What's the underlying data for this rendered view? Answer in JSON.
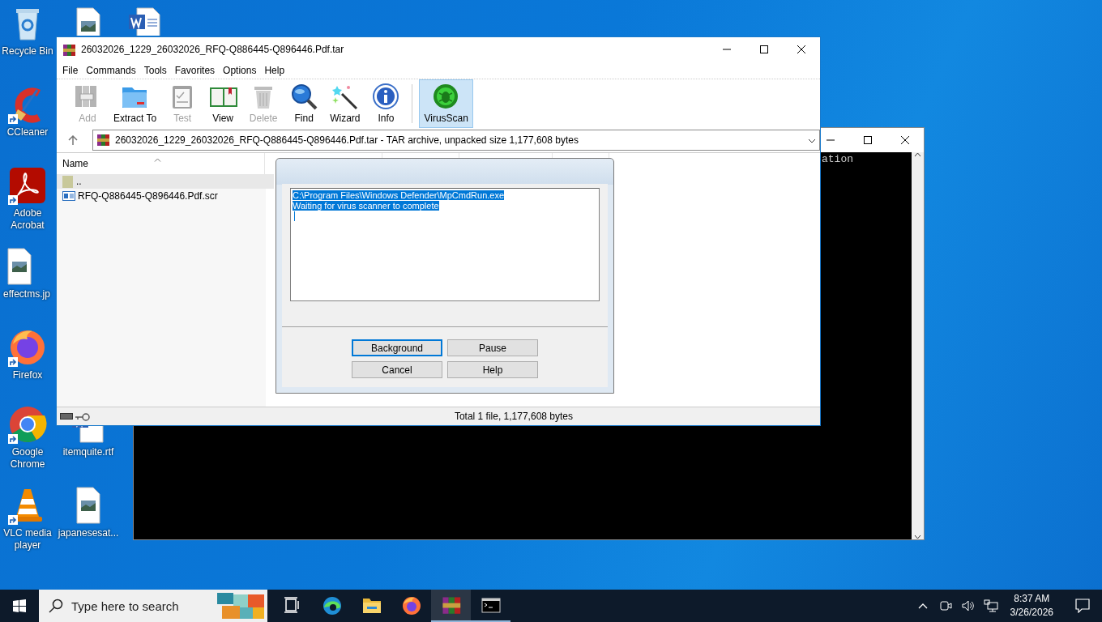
{
  "desktop_icons": [
    {
      "kind": "recycle",
      "label": "Recycle Bin",
      "shortcut": false
    },
    {
      "kind": "image"
    },
    {
      "kind": "word"
    },
    {
      "kind": "ccleaner",
      "label": "CCleaner",
      "shortcut": true
    },
    {
      "kind": "acrobat",
      "label": "Adobe Acrobat",
      "shortcut": true
    },
    {
      "kind": "image",
      "label": "effectms.jp",
      "shortcut": false
    },
    {
      "kind": "firefox",
      "label": "Firefox",
      "shortcut": true
    },
    {
      "kind": "chrome",
      "label": "Google Chrome",
      "shortcut": true
    },
    {
      "kind": "word",
      "label": "itemquite.rtf",
      "shortcut": false
    },
    {
      "kind": "vlc",
      "label": "VLC media player",
      "shortcut": true
    },
    {
      "kind": "image",
      "label": "japanesesat...",
      "shortcut": false
    }
  ],
  "console_window": {
    "visible_text": "ation"
  },
  "archive_window": {
    "title": "26032026_1229_26032026_RFQ-Q886445-Q896446.Pdf.tar",
    "menu": [
      "File",
      "Commands",
      "Tools",
      "Favorites",
      "Options",
      "Help"
    ],
    "toolbar": [
      {
        "kind": "add",
        "label": "Add",
        "disabled": true,
        "selected": false
      },
      {
        "kind": "extract",
        "label": "Extract To",
        "disabled": false,
        "selected": false
      },
      {
        "kind": "test",
        "label": "Test",
        "disabled": true,
        "selected": false
      },
      {
        "kind": "view",
        "label": "View",
        "disabled": false,
        "selected": false
      },
      {
        "kind": "delete",
        "label": "Delete",
        "disabled": true,
        "selected": false
      },
      {
        "kind": "find",
        "label": "Find",
        "disabled": false,
        "selected": false
      },
      {
        "kind": "wizard",
        "label": "Wizard",
        "disabled": false,
        "selected": false
      },
      {
        "kind": "info",
        "label": "Info",
        "disabled": false,
        "selected": false
      },
      {
        "kind": "virus",
        "label": "VirusScan",
        "disabled": false,
        "selected": true
      }
    ],
    "address": "26032026_1229_26032026_RFQ-Q886445-Q896446.Pdf.tar - TAR archive, unpacked size 1,177,608 bytes",
    "columns": [
      "Name"
    ],
    "files": [
      {
        "kind": "up",
        "name": "..",
        "selected": true
      },
      {
        "kind": "file",
        "name": "RFQ-Q886445-Q896446.Pdf.scr",
        "selected": false
      }
    ],
    "status": "Total 1 file, 1,177,608 bytes"
  },
  "scan_dialog": {
    "log_lines": [
      "C:\\Program Files\\Windows Defender\\MpCmdRun.exe",
      "Waiting for virus scanner to complete"
    ],
    "buttons": [
      {
        "label": "Background",
        "focused": true
      },
      {
        "label": "Pause",
        "focused": false
      },
      {
        "label": "Cancel",
        "focused": false
      },
      {
        "label": "Help",
        "focused": false
      }
    ]
  },
  "taskbar": {
    "search_placeholder": "Type here to search",
    "apps": [
      {
        "kind": "taskview",
        "active": false,
        "running": false
      },
      {
        "kind": "edge",
        "active": false,
        "running": false
      },
      {
        "kind": "explorer",
        "active": false,
        "running": false
      },
      {
        "kind": "firefox",
        "active": false,
        "running": false
      },
      {
        "kind": "winrar",
        "active": true,
        "running": true
      },
      {
        "kind": "console",
        "active": false,
        "running": true
      }
    ],
    "time": "8:37 AM",
    "date": "3/26/2026"
  }
}
